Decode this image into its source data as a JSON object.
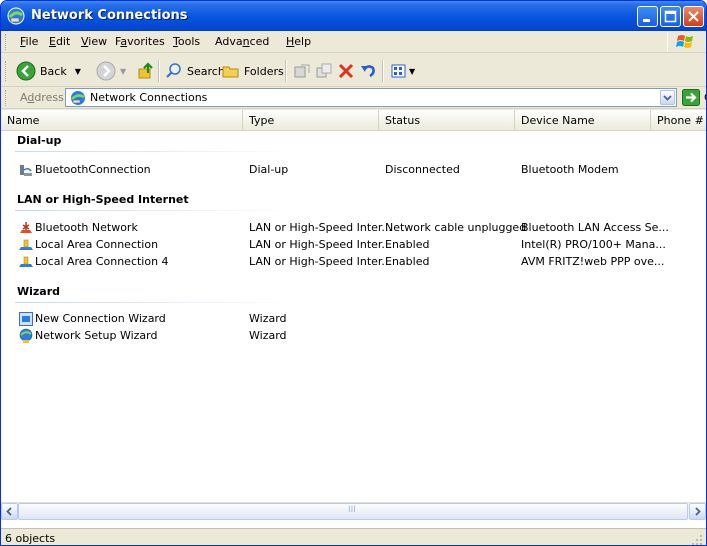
{
  "window": {
    "title": "Network Connections"
  },
  "menu": [
    {
      "pre": "",
      "u": "F",
      "post": "ile"
    },
    {
      "pre": "",
      "u": "E",
      "post": "dit"
    },
    {
      "pre": "",
      "u": "V",
      "post": "iew"
    },
    {
      "pre": "F",
      "u": "a",
      "post": "vorites"
    },
    {
      "pre": "",
      "u": "T",
      "post": "ools"
    },
    {
      "pre": "Adva",
      "u": "n",
      "post": "ced"
    },
    {
      "pre": "",
      "u": "H",
      "post": "elp"
    }
  ],
  "toolbar": {
    "back": "Back",
    "search": "Search",
    "folders": "Folders"
  },
  "address": {
    "label": "Address",
    "label_u": "d",
    "value": "Network Connections",
    "go": "Go"
  },
  "columns": [
    "Name",
    "Type",
    "Status",
    "Device Name",
    "Phone #"
  ],
  "groups": [
    {
      "title": "Dial-up",
      "rows": [
        {
          "icon": "dialup-connection-icon",
          "name": "BluetoothConnection",
          "type": "Dial-up",
          "status": "Disconnected",
          "device": "Bluetooth Modem"
        }
      ]
    },
    {
      "title": "LAN or High-Speed Internet",
      "rows": [
        {
          "icon": "bluetooth-network-icon",
          "name": "Bluetooth Network",
          "type": "LAN or High-Speed Inter...",
          "status": "Network cable unplugged",
          "device": "Bluetooth LAN Access Se..."
        },
        {
          "icon": "lan-connection-icon",
          "name": "Local Area Connection",
          "type": "LAN or High-Speed Inter...",
          "status": "Enabled",
          "device": "Intel(R) PRO/100+ Mana..."
        },
        {
          "icon": "lan-connection-icon",
          "name": "Local Area Connection 4",
          "type": "LAN or High-Speed Inter...",
          "status": "Enabled",
          "device": "AVM FRITZ!web PPP ove..."
        }
      ]
    },
    {
      "title": "Wizard",
      "rows": [
        {
          "icon": "new-connection-wizard-icon",
          "name": "New Connection Wizard",
          "type": "Wizard",
          "status": "",
          "device": ""
        },
        {
          "icon": "network-setup-wizard-icon",
          "name": "Network Setup Wizard",
          "type": "Wizard",
          "status": "",
          "device": ""
        }
      ]
    }
  ],
  "scrollbar": {
    "grip": "III"
  },
  "status": {
    "text": "6 objects"
  },
  "colors": {
    "titlebar": "#0a55e0",
    "chrome": "#ece9d8",
    "group_line": "#c9d6f2"
  }
}
